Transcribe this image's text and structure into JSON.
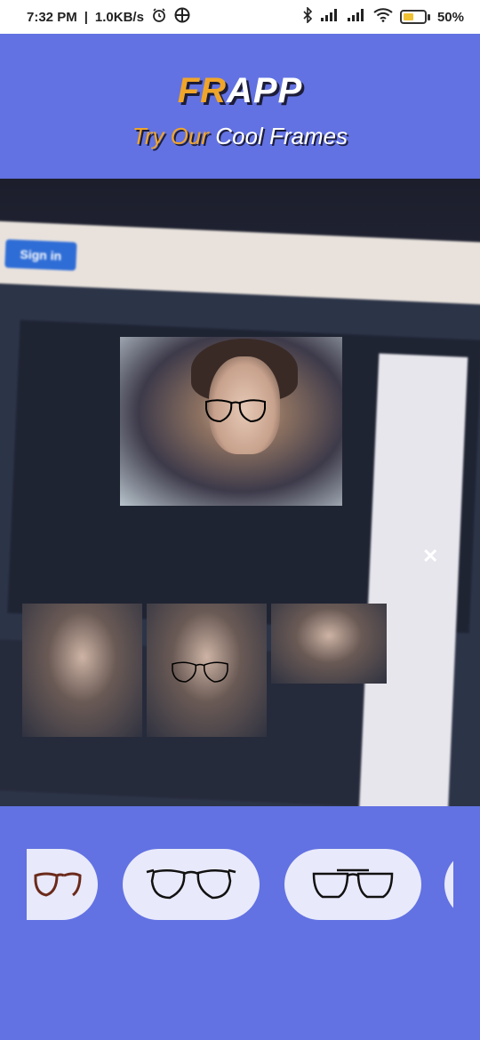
{
  "status_bar": {
    "time": "7:32 PM",
    "speed": "1.0KB/s",
    "battery_text": "50%",
    "battery_level": 0.5,
    "icons": [
      "alarm-icon",
      "vpn-icon",
      "bluetooth-icon",
      "signal-icon",
      "signal-icon",
      "wifi-icon",
      "battery-icon"
    ]
  },
  "header": {
    "title_accent": "FR",
    "title_rest": "APP",
    "tagline_accent": "Try Our",
    "tagline_rest": " Cool Frames"
  },
  "camera_preview": {
    "signin_label": "Sign in",
    "close_label": "✕"
  },
  "frames": [
    {
      "icon": "cat-eye-glasses-icon"
    },
    {
      "icon": "aviator-glasses-icon"
    },
    {
      "icon": "double-bridge-glasses-icon"
    },
    {
      "icon": "partial-frame-icon"
    }
  ],
  "colors": {
    "brand": "#6272e2",
    "accent": "#f0a52a",
    "chip": "#e8e9fb"
  }
}
